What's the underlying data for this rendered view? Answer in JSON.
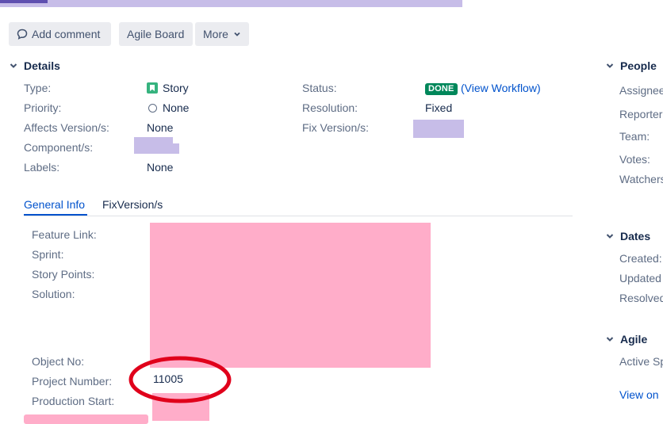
{
  "toolbar": {
    "add_comment": "Add comment",
    "agile_board": "Agile Board",
    "more": "More"
  },
  "details": {
    "title": "Details",
    "left": [
      {
        "label": "Type:",
        "value": "Story"
      },
      {
        "label": "Priority:",
        "value": "None"
      },
      {
        "label": "Affects Version/s:",
        "value": "None"
      },
      {
        "label": "Component/s:",
        "value": ""
      },
      {
        "label": "Labels:",
        "value": "None"
      }
    ],
    "right": [
      {
        "label": "Status:",
        "badge": "DONE",
        "link": "(View Workflow)"
      },
      {
        "label": "Resolution:",
        "value": "Fixed"
      },
      {
        "label": "Fix Version/s:",
        "value": ""
      }
    ]
  },
  "tabs": [
    "General Info",
    "FixVersion/s"
  ],
  "general_info": {
    "labels": [
      "Feature Link:",
      "Sprint:",
      "Story Points:",
      "Solution:",
      "Object No:",
      "Project Number:",
      "Production Start:"
    ],
    "project_number": "11005"
  },
  "people": {
    "title": "People",
    "labels": [
      "Assignee",
      "Reporter",
      "Team:",
      "Votes:",
      "Watchers"
    ]
  },
  "dates": {
    "title": "Dates",
    "labels": [
      "Created:",
      "Updated",
      "Resolved"
    ]
  },
  "agile": {
    "title": "Agile",
    "labels": [
      "Active Sp"
    ],
    "view_link": "View on"
  },
  "colors": {
    "accent": "#0052cc",
    "done_badge": "#00875a",
    "annotation_circle": "#e0001b"
  }
}
